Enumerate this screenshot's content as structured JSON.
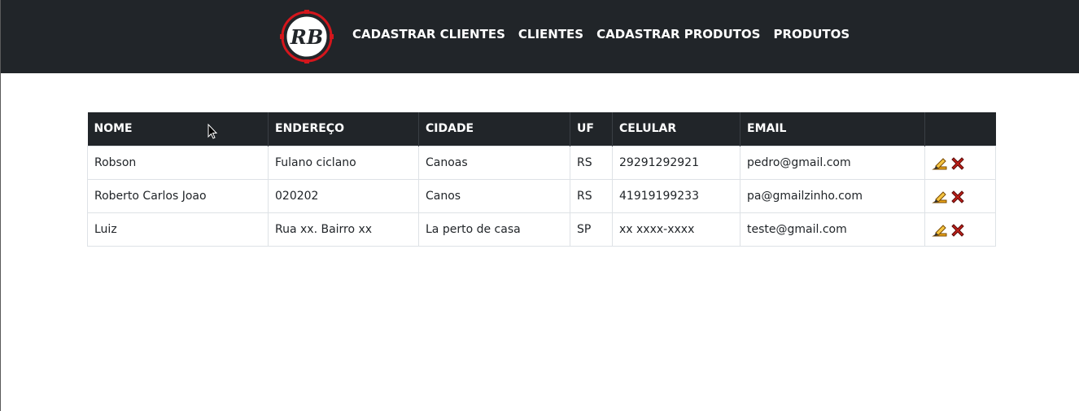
{
  "navbar": {
    "logo_text": "RB",
    "links": [
      {
        "label": "CADASTRAR CLIENTES"
      },
      {
        "label": "CLIENTES"
      },
      {
        "label": "CADASTRAR PRODUTOS"
      },
      {
        "label": "PRODUTOS"
      }
    ]
  },
  "table": {
    "columns": [
      "NOME",
      "ENDEREÇO",
      "CIDADE",
      "UF",
      "CELULAR",
      "EMAIL",
      ""
    ],
    "rows": [
      {
        "nome": "Robson",
        "endereco": "Fulano ciclano",
        "cidade": "Canoas",
        "uf": "RS",
        "celular": "29291292921",
        "email": "pedro@gmail.com"
      },
      {
        "nome": "Roberto Carlos Joao",
        "endereco": "020202",
        "cidade": "Canos",
        "uf": "RS",
        "celular": "41919199233",
        "email": "pa@gmailzinho.com"
      },
      {
        "nome": "Luiz",
        "endereco": "Rua xx. Bairro xx",
        "cidade": "La perto de casa",
        "uf": "SP",
        "celular": "xx xxxx-xxxx",
        "email": "teste@gmail.com"
      }
    ],
    "row_actions": [
      {
        "icon": "pencil-edit-icon"
      },
      {
        "icon": "red-x-delete-icon"
      }
    ]
  },
  "colors": {
    "navbar_bg": "#212529",
    "header_bg": "#212529",
    "logo_red": "#d4161c",
    "delete_red": "#c0201a",
    "edit_orange": "#e8a317"
  }
}
